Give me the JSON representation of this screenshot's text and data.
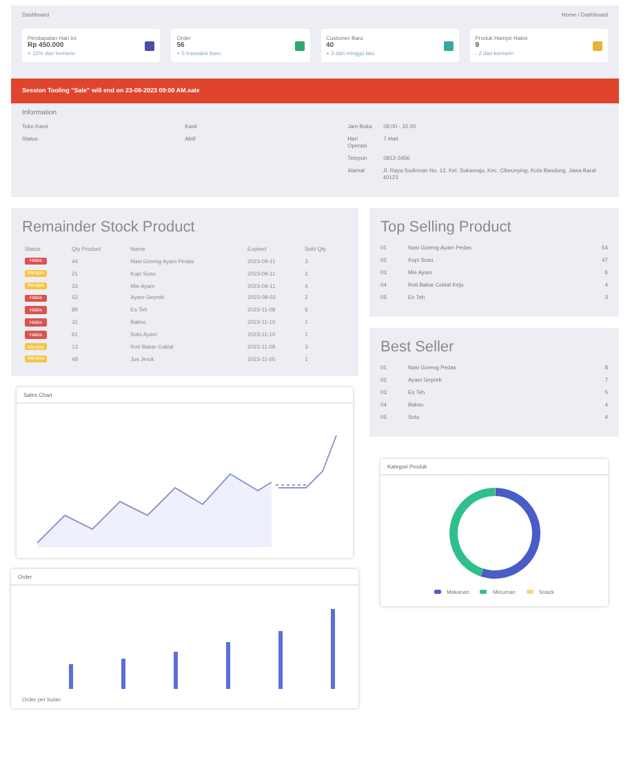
{
  "header": {
    "title": "Dashboard",
    "breadcrumb": "Home / Dashboard"
  },
  "stats": [
    {
      "label": "Pendapatan Hari Ini",
      "value": "Rp 450.000",
      "note": "+ 12% dari kemarin",
      "color": "#4b4fa8"
    },
    {
      "label": "Order",
      "value": "56",
      "note": "+ 5 transaksi baru",
      "color": "#2fa56f"
    },
    {
      "label": "Customer Baru",
      "value": "40",
      "note": "+ 3 dari minggu lalu",
      "color": "#3aa6a0"
    },
    {
      "label": "Produk Hampir Habis",
      "value": "9",
      "note": "- 2 dari kemarin",
      "color": "#e8b234"
    }
  ],
  "alert": {
    "text": "Session Tooling \"Sale\" will end on 23-08-2023 09:00 AM.sale"
  },
  "info": {
    "title": "Information",
    "columns": [
      [
        {
          "label": "Toko Kami"
        },
        {
          "label": "Status"
        }
      ],
      [
        {
          "label": "Kasir"
        },
        {
          "label": "Aktif"
        }
      ],
      [
        {
          "label": "Jam Buka",
          "value": "08.00 - 22.00"
        },
        {
          "label": "Hari Operasi",
          "value": "7 Hari"
        },
        {
          "label": "Telepon",
          "value": "0812-3456"
        },
        {
          "label": "Alamat",
          "value": "Jl. Raya Sudirman No. 12, Kel. Sukamaju, Kec. Cibeunying, Kota Bandung, Jawa Barat 40123"
        }
      ]
    ]
  },
  "stock": {
    "title": "Remainder Stock Product",
    "columns": [
      "Status",
      "Qty Product",
      "Name",
      "Expired",
      "Sold Qty"
    ],
    "rows": [
      {
        "status": "Habis",
        "color": "#d9534f",
        "qty": "44",
        "name": "Nasi Goreng Ayam Pedas",
        "date": "2023-09-11",
        "sold": "3"
      },
      {
        "status": "Menipis",
        "color": "#f5c542",
        "qty": "21",
        "name": "Kopi Susu",
        "date": "2023-09-11",
        "sold": "2"
      },
      {
        "status": "Menipis",
        "color": "#f5c542",
        "qty": "33",
        "name": "Mie Ayam",
        "date": "2023-09-11",
        "sold": "4"
      },
      {
        "status": "Habis",
        "color": "#d9534f",
        "qty": "53",
        "name": "Ayam Geprek",
        "date": "2023-08-02",
        "sold": "2"
      },
      {
        "status": "Habis",
        "color": "#d9534f",
        "qty": "89",
        "name": "Es Teh",
        "date": "2023-11-08",
        "sold": "6"
      },
      {
        "status": "Habis",
        "color": "#d9534f",
        "qty": "31",
        "name": "Bakso",
        "date": "2023-11-10",
        "sold": "1"
      },
      {
        "status": "Habis",
        "color": "#d9534f",
        "qty": "61",
        "name": "Soto Ayam",
        "date": "2023-11-10",
        "sold": "1"
      },
      {
        "status": "Menipis",
        "color": "#f5c542",
        "qty": "13",
        "name": "Roti Bakar Coklat",
        "date": "2023-11-09",
        "sold": "3"
      },
      {
        "status": "Menipis",
        "color": "#f5c542",
        "qty": "48",
        "name": "Jus Jeruk",
        "date": "2023-11-05",
        "sold": "1"
      }
    ]
  },
  "top_selling": {
    "title": "Top Selling Product",
    "rows": [
      {
        "rank": "01",
        "name": "Nasi Goreng Ayam Pedas",
        "count": "54"
      },
      {
        "rank": "02",
        "name": "Kopi Susu",
        "count": "47"
      },
      {
        "rank": "03",
        "name": "Mie Ayam",
        "count": "6"
      },
      {
        "rank": "04",
        "name": "Roti Bakar Coklat Keju",
        "count": "4"
      },
      {
        "rank": "05",
        "name": "Es Teh",
        "count": "3"
      }
    ]
  },
  "best_seller": {
    "title": "Best Seller",
    "rows": [
      {
        "rank": "01",
        "name": "Nasi Goreng Pedas",
        "count": "8"
      },
      {
        "rank": "02",
        "name": "Ayam Geprek",
        "count": "7"
      },
      {
        "rank": "03",
        "name": "Es Teh",
        "count": "5"
      },
      {
        "rank": "04",
        "name": "Bakso",
        "count": "4"
      },
      {
        "rank": "05",
        "name": "Soto",
        "count": "4"
      }
    ]
  },
  "sales_chart": {
    "title": "Sales Chart"
  },
  "donut": {
    "title": "Kategori Produk",
    "legend": [
      {
        "label": "Makanan",
        "color": "#4a5cc8"
      },
      {
        "label": "Minuman",
        "color": "#2fbf8a"
      },
      {
        "label": "Snack",
        "color": "#f5d76e"
      }
    ]
  },
  "bar_chart": {
    "title": "Order",
    "footer": "Order per bulan"
  }
}
